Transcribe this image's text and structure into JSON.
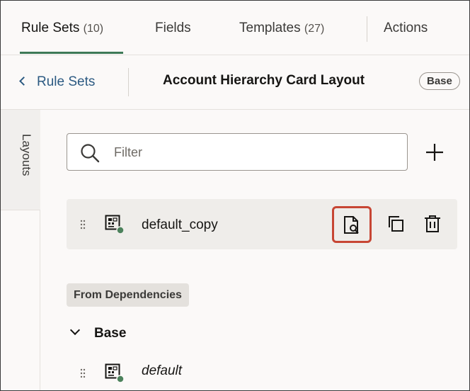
{
  "tabs": [
    {
      "label": "Rule Sets",
      "count": "(10)",
      "active": true
    },
    {
      "label": "Fields",
      "count": ""
    },
    {
      "label": "Templates",
      "count": "(27)"
    },
    {
      "label": "Actions",
      "count": ""
    }
  ],
  "breadcrumb": {
    "back_label": "Rule Sets",
    "title": "Account Hierarchy Card Layout",
    "badge": "Base"
  },
  "side_rail": {
    "tab_label": "Layouts"
  },
  "filter": {
    "placeholder": "Filter",
    "value": ""
  },
  "layouts": [
    {
      "name": "default_copy",
      "icon": "layout-grid-icon",
      "status_color": "#4c825c",
      "highlighted_action": "preview"
    }
  ],
  "dependencies": {
    "section_label": "From Dependencies",
    "group_label": "Base",
    "items": [
      {
        "name": "default",
        "icon": "layout-grid-icon",
        "status_color": "#4c825c"
      }
    ]
  },
  "colors": {
    "accent": "#3e7a57",
    "link": "#2c5a82",
    "highlight": "#c74634"
  }
}
